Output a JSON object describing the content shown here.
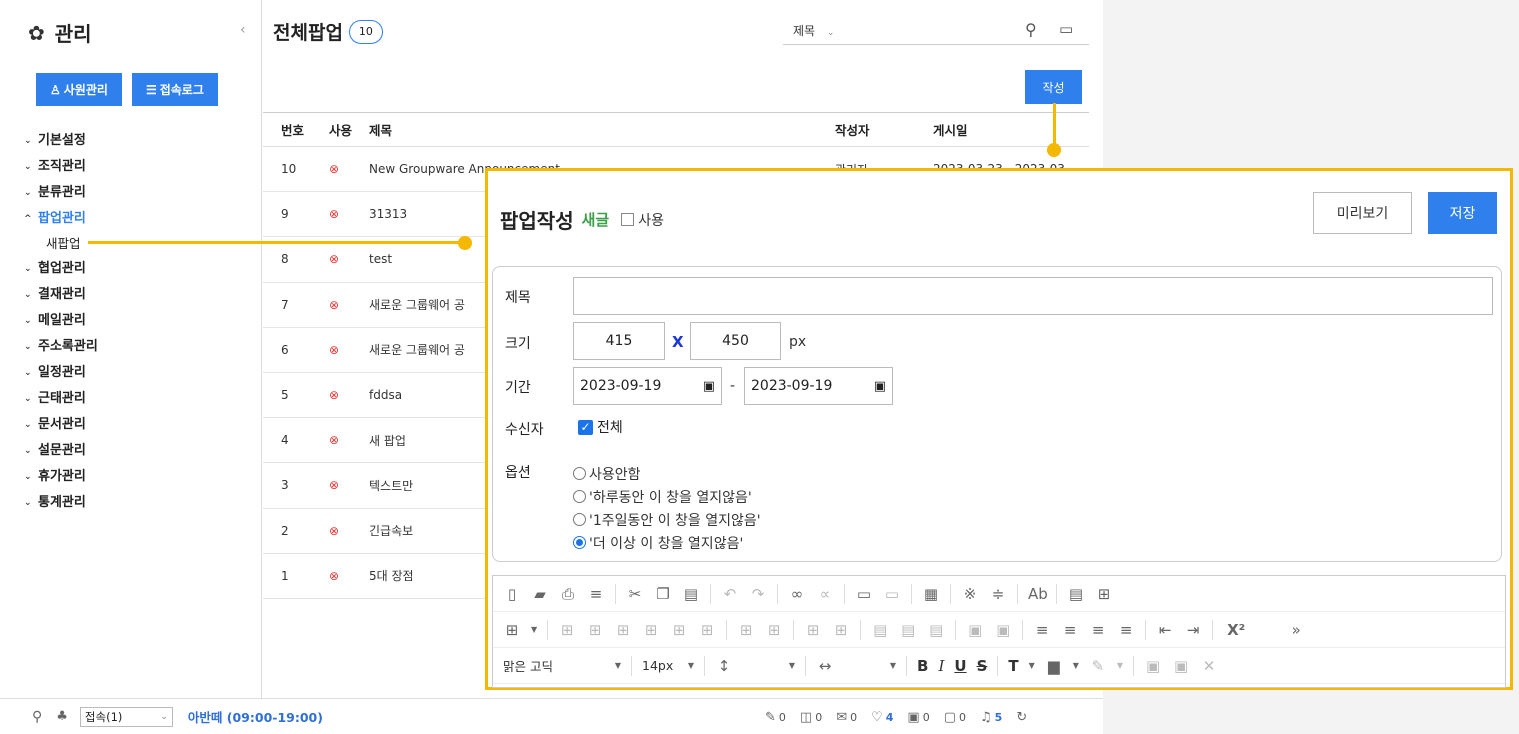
{
  "sidebar": {
    "title": "관리",
    "buttons": {
      "employee": "사원관리",
      "access_log": "접속로그"
    },
    "menu": [
      {
        "label": "기본설정",
        "state": "closed"
      },
      {
        "label": "조직관리",
        "state": "closed"
      },
      {
        "label": "분류관리",
        "state": "closed"
      },
      {
        "label": "팝업관리",
        "state": "open"
      },
      {
        "label": "새팝업",
        "state": "sub"
      },
      {
        "label": "협업관리",
        "state": "closed"
      },
      {
        "label": "결재관리",
        "state": "closed"
      },
      {
        "label": "메일관리",
        "state": "closed"
      },
      {
        "label": "주소록관리",
        "state": "closed"
      },
      {
        "label": "일정관리",
        "state": "closed"
      },
      {
        "label": "근태관리",
        "state": "closed"
      },
      {
        "label": "문서관리",
        "state": "closed"
      },
      {
        "label": "설문관리",
        "state": "closed"
      },
      {
        "label": "휴가관리",
        "state": "closed"
      },
      {
        "label": "통계관리",
        "state": "closed"
      }
    ]
  },
  "main": {
    "title": "전체팝업",
    "count": "10",
    "search_field": "제목",
    "write_label": "작성",
    "columns": [
      "번호",
      "사용",
      "제목",
      "작성자",
      "게시일"
    ],
    "rows": [
      {
        "no": "10",
        "title": "New Groupware Announcement",
        "author": "관리자",
        "date": "2023-03-23 - 2023-03-"
      },
      {
        "no": "9",
        "title": "31313",
        "author": "",
        "date": ""
      },
      {
        "no": "8",
        "title": "test",
        "author": "",
        "date": ""
      },
      {
        "no": "7",
        "title": "새로운 그룹웨어 공",
        "author": "",
        "date": ""
      },
      {
        "no": "6",
        "title": "새로운 그룹웨어 공",
        "author": "",
        "date": ""
      },
      {
        "no": "5",
        "title": "fddsa",
        "author": "",
        "date": ""
      },
      {
        "no": "4",
        "title": "새 팝업",
        "author": "",
        "date": ""
      },
      {
        "no": "3",
        "title": "텍스트만",
        "author": "",
        "date": ""
      },
      {
        "no": "2",
        "title": "긴급속보",
        "author": "",
        "date": ""
      },
      {
        "no": "1",
        "title": "5대 장점",
        "author": "",
        "date": ""
      }
    ]
  },
  "status": {
    "connect_select": "접속(1)",
    "work_status": "아반떼 (09:00-19:00)",
    "counters": [
      {
        "icon": "pen-icon",
        "value": "0",
        "highlight": false
      },
      {
        "icon": "box-icon",
        "value": "0",
        "highlight": false
      },
      {
        "icon": "mail-icon",
        "value": "0",
        "highlight": false
      },
      {
        "icon": "shield-check-icon",
        "value": "4",
        "highlight": true
      },
      {
        "icon": "calendar-icon",
        "value": "0",
        "highlight": false
      },
      {
        "icon": "chat-icon",
        "value": "0",
        "highlight": false
      },
      {
        "icon": "bell-icon",
        "value": "5",
        "highlight": true
      }
    ]
  },
  "popup": {
    "title": "팝업작성",
    "new_badge": "새글",
    "use_label": "사용",
    "preview_label": "미리보기",
    "save_label": "저장",
    "fields": {
      "title_label": "제목",
      "title_value": "",
      "size_label": "크기",
      "width": "415",
      "x_sep": "X",
      "height": "450",
      "unit": "px",
      "period_label": "기간",
      "date_start": "2023-09-19",
      "date_end": "2023-09-19",
      "date_sep": "-",
      "recipient_label": "수신자",
      "recipient_all": "전체",
      "option_label": "옵션"
    },
    "options": [
      {
        "label": "사용안함",
        "selected": false
      },
      {
        "label": "'하루동안 이 창을 열지않음'",
        "selected": false
      },
      {
        "label": "'1주일동안 이 창을 열지않음'",
        "selected": false
      },
      {
        "label": "'더 이상 이 창을 열지않음'",
        "selected": true
      }
    ],
    "editor": {
      "font_family": "맑은 고딕",
      "font_size": "14px",
      "superscript": "X²"
    }
  },
  "colors": {
    "accent": "#2f80ed",
    "callout": "#f5b800",
    "new_badge": "#3ea04b",
    "delete_mark": "#e53935"
  }
}
